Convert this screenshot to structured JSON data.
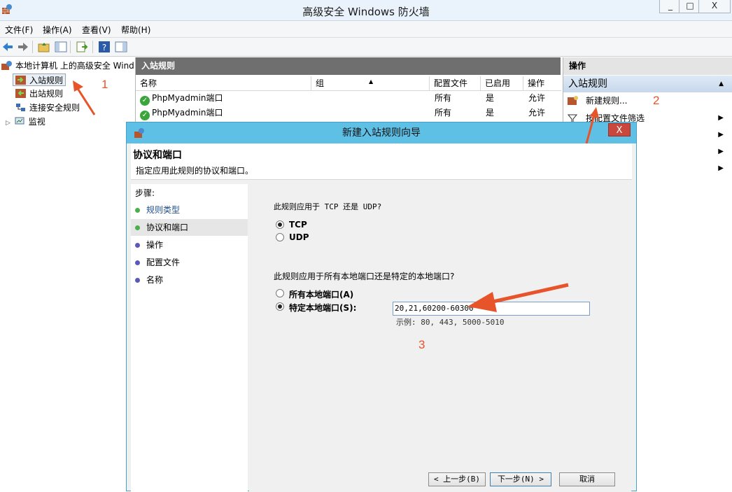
{
  "window": {
    "title": "高级安全 Windows 防火墙",
    "minimize": "_",
    "maximize": "□",
    "close": "X"
  },
  "menu": [
    "文件(F)",
    "操作(A)",
    "查看(V)",
    "帮助(H)"
  ],
  "tree": {
    "root": "本地计算机 上的高级安全 Wind",
    "items": [
      "入站规则",
      "出站规则",
      "连接安全规则",
      "监视"
    ]
  },
  "center": {
    "header": "入站规则",
    "columns": [
      "名称",
      "组",
      "配置文件",
      "已启用",
      "操作"
    ],
    "rows": [
      {
        "name": "PhpMyadmin端口",
        "group": "",
        "profile": "所有",
        "enabled": "是",
        "action": "允许"
      },
      {
        "name": "PhpMyadmin端口",
        "group": "",
        "profile": "所有",
        "enabled": "是",
        "action": "允许"
      }
    ]
  },
  "actions": {
    "header": "操作",
    "section": "入站规则",
    "items": [
      "新建规则...",
      "按配置文件筛选"
    ]
  },
  "dialog": {
    "title": "新建入站规则向导",
    "close": "X",
    "heading": "协议和端口",
    "subheading": "指定应用此规则的协议和端口。",
    "steps_title": "步骤:",
    "steps": [
      "规则类型",
      "协议和端口",
      "操作",
      "配置文件",
      "名称"
    ],
    "q_protocol": "此规则应用于 TCP 还是 UDP?",
    "protocols": [
      "TCP",
      "UDP"
    ],
    "q_ports": "此规则应用于所有本地端口还是特定的本地端口?",
    "port_options": [
      "所有本地端口(A)",
      "特定本地端口(S):"
    ],
    "port_value": "20,21,60200-60300",
    "example": "示例: 80, 443, 5000-5010",
    "buttons": {
      "back": "< 上一步(B)",
      "next": "下一步(N) >",
      "cancel": "取消"
    }
  },
  "annotations": [
    "1",
    "2",
    "3"
  ],
  "colors": {
    "dialog_title": "#5fc0e6",
    "annotation": "#e8542a",
    "close_red": "#c9473c"
  }
}
